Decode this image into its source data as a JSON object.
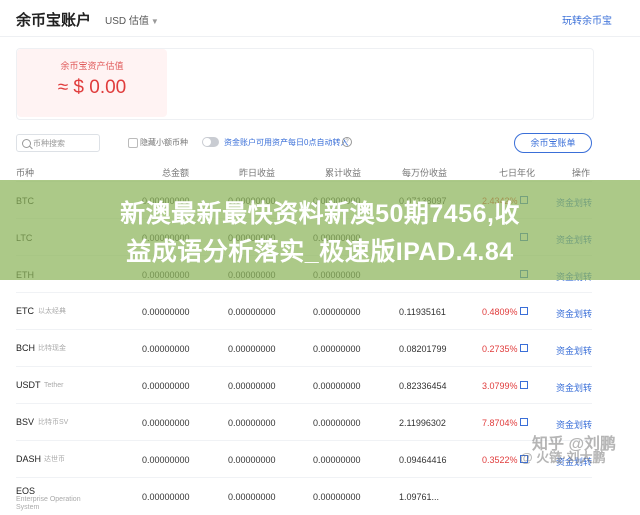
{
  "header": {
    "title": "余币宝账户",
    "currency": "USD 估值",
    "right_link": "玩转余币宝"
  },
  "assets_card": {
    "label": "余币宝资产估值",
    "value": "≈ $ 0.00"
  },
  "toolbar": {
    "search_placeholder": "币种搜索",
    "hide_small_label": "隐藏小额币种",
    "auto_transfer_label": "资金账户可用资产每日0点自动转入",
    "info_icon": "?",
    "ledger_button": "余币宝账单"
  },
  "table": {
    "headers": [
      "币种",
      "总金额",
      "昨日收益",
      "累计收益",
      "每万份收益",
      "七日年化",
      "操作"
    ],
    "rows": [
      {
        "coin": "BTC",
        "sub": "",
        "total": "0.00000000",
        "yesterday": "0.00000000",
        "cumulative": "0.00000000",
        "per10k": "0.07138097",
        "apy": "2.4342%",
        "action": "资金划转"
      },
      {
        "coin": "LTC",
        "sub": "",
        "total": "0.00000000",
        "yesterday": "0.00000000",
        "cumulative": "0.00000000",
        "per10k": "",
        "apy": "",
        "action": "资金划转"
      },
      {
        "coin": "ETH",
        "sub": "",
        "total": "0.00000000",
        "yesterday": "0.00000000",
        "cumulative": "0.00000000",
        "per10k": "",
        "apy": "",
        "action": "资金划转"
      },
      {
        "coin": "ETC",
        "sub": "以太经典",
        "total": "0.00000000",
        "yesterday": "0.00000000",
        "cumulative": "0.00000000",
        "per10k": "0.11935161",
        "apy": "0.4809%",
        "action": "资金划转"
      },
      {
        "coin": "BCH",
        "sub": "比特现金",
        "total": "0.00000000",
        "yesterday": "0.00000000",
        "cumulative": "0.00000000",
        "per10k": "0.08201799",
        "apy": "0.2735%",
        "action": "资金划转"
      },
      {
        "coin": "USDT",
        "sub": "Tether",
        "total": "0.00000000",
        "yesterday": "0.00000000",
        "cumulative": "0.00000000",
        "per10k": "0.82336454",
        "apy": "3.0799%",
        "action": "资金划转"
      },
      {
        "coin": "BSV",
        "sub": "比特币SV",
        "total": "0.00000000",
        "yesterday": "0.00000000",
        "cumulative": "0.00000000",
        "per10k": "2.11996302",
        "apy": "7.8704%",
        "action": "资金划转"
      },
      {
        "coin": "DASH",
        "sub": "达世币",
        "total": "0.00000000",
        "yesterday": "0.00000000",
        "cumulative": "0.00000000",
        "per10k": "0.09464416",
        "apy": "0.3522%",
        "action": "资金划转"
      },
      {
        "coin": "EOS",
        "sub": "Enterprise Operation System",
        "total": "0.00000000",
        "yesterday": "0.00000000",
        "cumulative": "0.00000000",
        "per10k": "1.09761...",
        "apy": "",
        "action": ""
      }
    ]
  },
  "banner": {
    "line1": "新澳最新最快资料新澳50期7456,收",
    "line2": "益成语分析落实_极速版IPAD.4.84"
  },
  "watermark": {
    "text1": "知乎 @刘鹏",
    "text2": "@ 火链·刘大鹏"
  }
}
